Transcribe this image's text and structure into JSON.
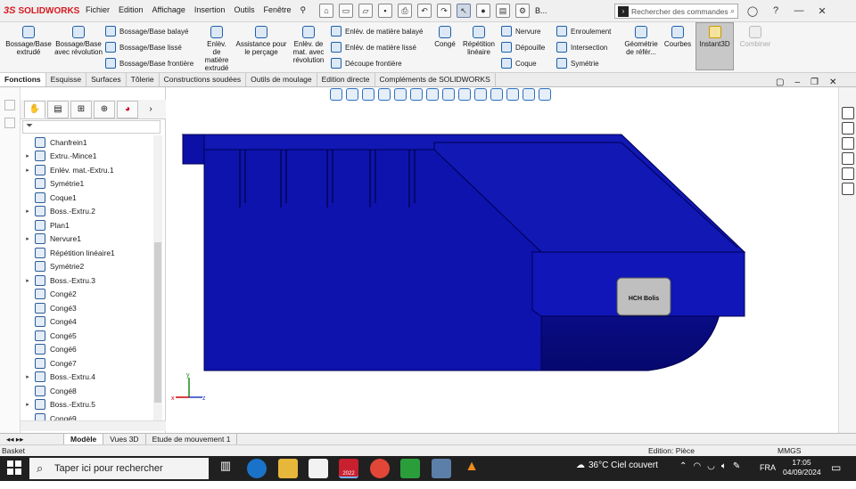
{
  "app": {
    "brand": "SOLIDWORKS",
    "brand_mark": "3S"
  },
  "menu": [
    "Fichier",
    "Edition",
    "Affichage",
    "Insertion",
    "Outils",
    "Fenêtre"
  ],
  "toolbar_overflow": "B...",
  "search": {
    "placeholder": "Rechercher des commandes"
  },
  "window_controls": {
    "minimize": "—",
    "close": "✕"
  },
  "ribbon": {
    "boss_extrude": "Bossage/Base extrudé",
    "boss_revolve": "Bossage/Base avec révolution",
    "boss_swept": "Bossage/Base balayé",
    "boss_loft": "Bossage/Base lissé",
    "boss_boundary": "Bossage/Base frontière",
    "cut_extrude": "Enlèv. de matière extrudé",
    "hole_wizard": "Assistance pour le perçage",
    "cut_revolve": "Enlèv. de mat. avec révolution",
    "cut_swept": "Enlèv. de matière balayé",
    "cut_loft": "Enlèv. de matière lissé",
    "cut_boundary": "Découpe frontière",
    "fillet": "Congé",
    "linear_pattern": "Répétition linéaire",
    "rib": "Nervure",
    "draft": "Dépouille",
    "shell": "Coque",
    "wrap": "Enroulement",
    "intersect": "Intersection",
    "mirror": "Symétrie",
    "ref_geometry": "Géométrie de référ...",
    "curves": "Courbes",
    "instant3d": "Instant3D",
    "combine": "Combiner"
  },
  "tabs": [
    "Fonctions",
    "Esquisse",
    "Surfaces",
    "Tôlerie",
    "Constructions soudées",
    "Outils de moulage",
    "Edition directe",
    "Compléments de SOLIDWORKS"
  ],
  "tree": [
    {
      "label": "Chanfrein1",
      "expand": false
    },
    {
      "label": "Extru.-Mince1",
      "expand": true
    },
    {
      "label": "Enlév. mat.-Extru.1",
      "expand": true
    },
    {
      "label": "Symétrie1",
      "expand": false
    },
    {
      "label": "Coque1",
      "expand": false
    },
    {
      "label": "Boss.-Extru.2",
      "expand": true
    },
    {
      "label": "Plan1",
      "expand": false
    },
    {
      "label": "Nervure1",
      "expand": true
    },
    {
      "label": "Répétition linéaire1",
      "expand": false
    },
    {
      "label": "Symétrie2",
      "expand": false
    },
    {
      "label": "Boss.-Extru.3",
      "expand": true
    },
    {
      "label": "Congé2",
      "expand": false
    },
    {
      "label": "Congé3",
      "expand": false
    },
    {
      "label": "Congé4",
      "expand": false
    },
    {
      "label": "Congé5",
      "expand": false
    },
    {
      "label": "Congé6",
      "expand": false
    },
    {
      "label": "Congé7",
      "expand": false
    },
    {
      "label": "Boss.-Extru.4",
      "expand": true
    },
    {
      "label": "Congé8",
      "expand": false
    },
    {
      "label": "Boss.-Extru.5",
      "expand": true
    },
    {
      "label": "Congé9",
      "expand": false
    }
  ],
  "model": {
    "label_text": "HCH Bolis",
    "body_color": "#0b0fa3",
    "label_color": "#bfbfbf"
  },
  "axes": {
    "x": "x",
    "y": "y",
    "z": "z"
  },
  "bottom_tabs": [
    "Modèle",
    "Vues 3D",
    "Etude de mouvement 1"
  ],
  "status": {
    "left": "Basket",
    "mode": "Edition: Pièce",
    "units": "MMGS"
  },
  "taskbar": {
    "search_placeholder": "Taper ici pour rechercher",
    "sw_badge": "2022",
    "weather": "36°C  Ciel couvert",
    "lang": "FRA",
    "time": "17:05",
    "date": "04/09/2024"
  }
}
